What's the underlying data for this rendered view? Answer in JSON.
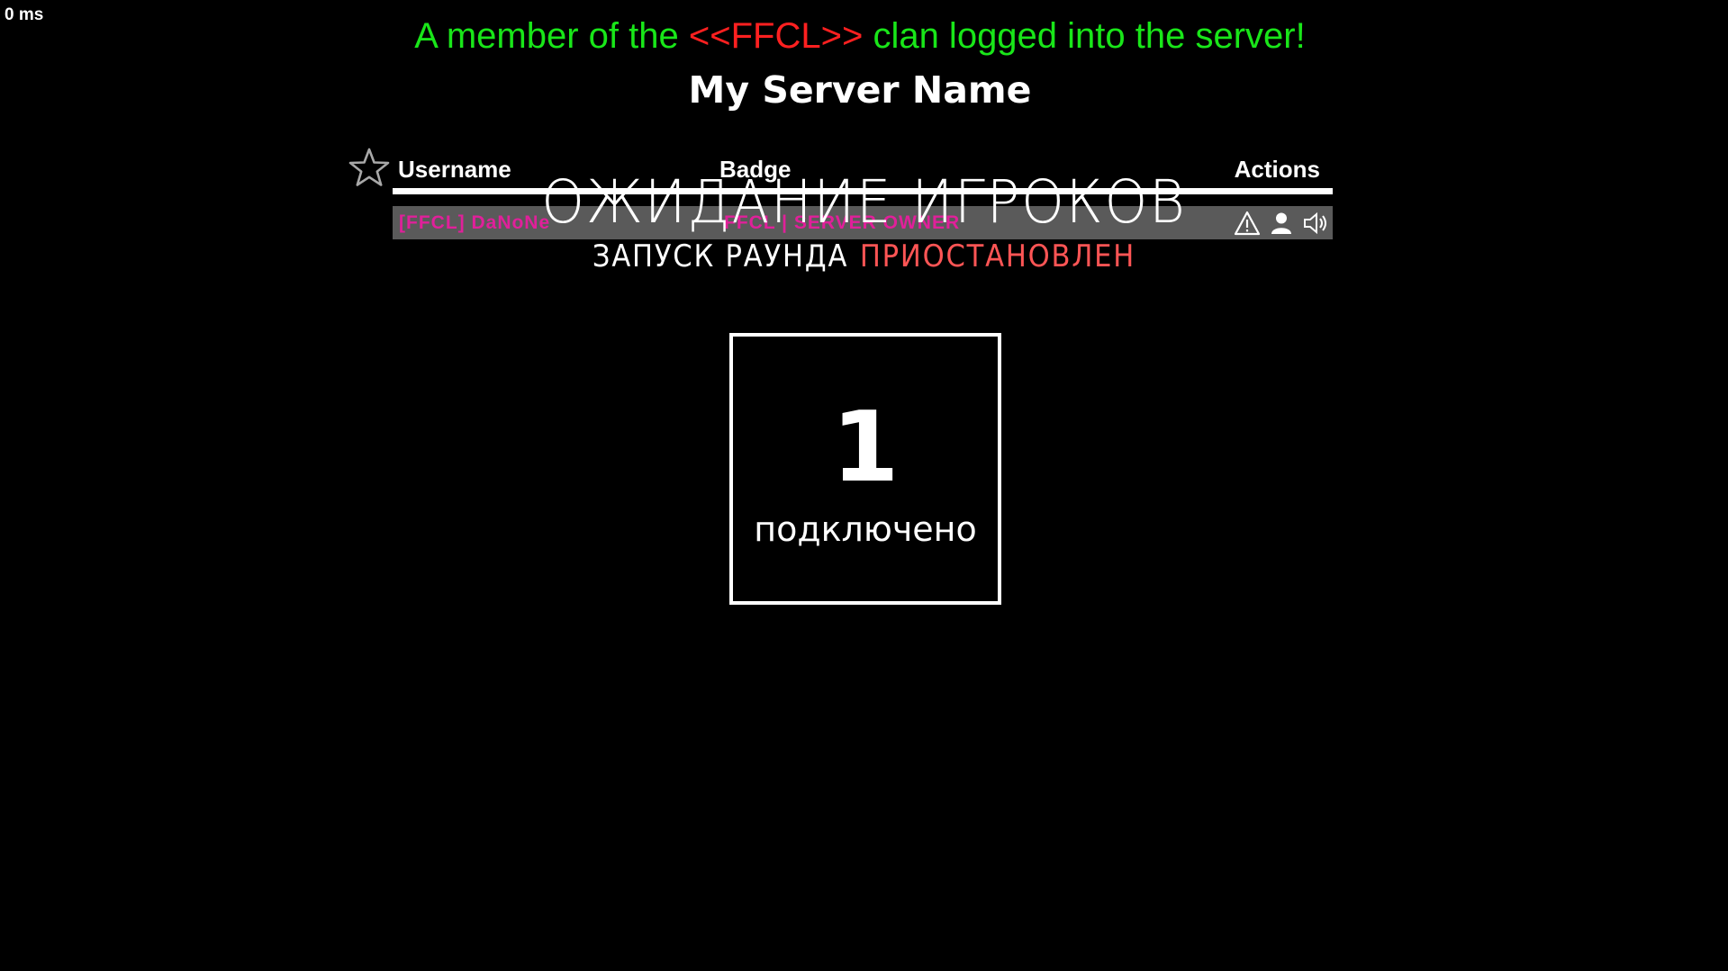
{
  "hud": {
    "ping": "0 ms"
  },
  "announcement": {
    "prefix": "A member of the",
    "clan": "<<FFCL>>",
    "suffix": "clan logged into the server!"
  },
  "server": {
    "name": "My Server Name"
  },
  "scoreboard": {
    "favorite_icon": "star-icon",
    "columns": {
      "username": "Username",
      "badge": "Badge",
      "actions": "Actions"
    },
    "rows": [
      {
        "username": "[FFCL] DaNoNe",
        "badge": "FFCL | SERVER OWNER",
        "actions": [
          "warning-icon",
          "profile-icon",
          "mute-icon"
        ]
      }
    ]
  },
  "round": {
    "waiting_text": "ОЖИДАНИЕ ИГРОКОВ",
    "status_label": "ЗАПУСК РАУНДА",
    "status_value": "ПРИОСТАНОВЛЕН"
  },
  "players": {
    "count": "1",
    "label": "подключено"
  },
  "colors": {
    "background": "#000000",
    "announce_green": "#19e619",
    "clan_red": "#ff2020",
    "status_red": "#ff5555",
    "badge_pink": "#e0209a",
    "row_gray": "#5a5a5a"
  }
}
